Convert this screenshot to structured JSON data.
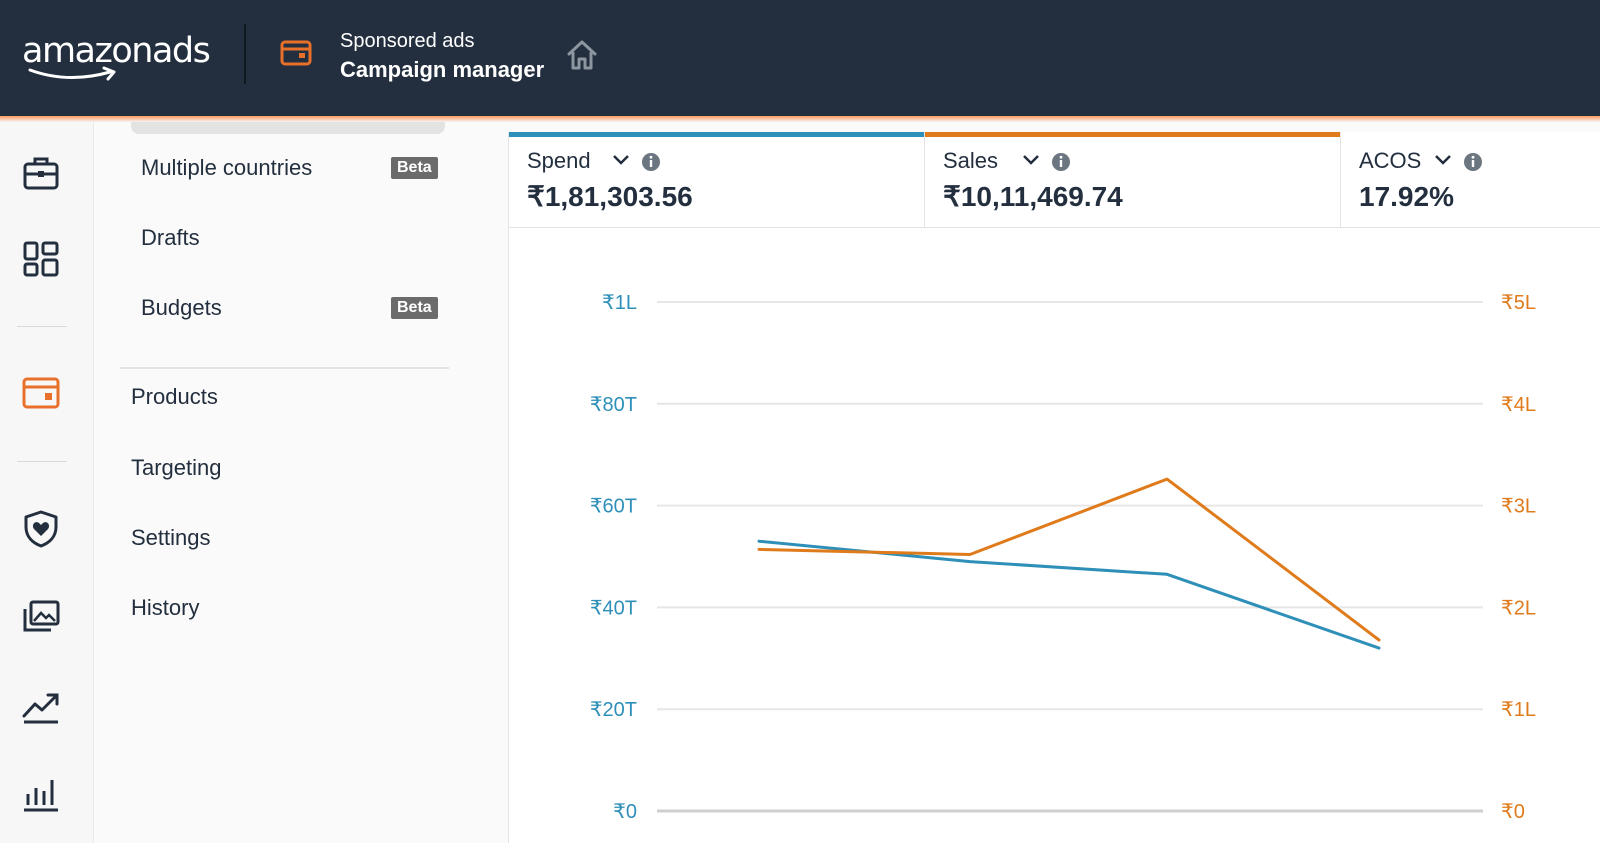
{
  "header": {
    "logo_text": "amazonads",
    "subtitle": "Sponsored ads",
    "title": "Campaign manager"
  },
  "rail": {
    "icons": [
      "briefcase-icon",
      "dashboard-icon",
      "campaign-card-icon",
      "shield-heart-icon",
      "media-library-icon",
      "trend-icon",
      "bar-chart-icon"
    ],
    "active_color": "#e8702a"
  },
  "subnav": {
    "items": [
      {
        "label": "Multiple countries",
        "badge": "Beta"
      },
      {
        "label": "Drafts"
      },
      {
        "label": "Budgets",
        "badge": "Beta"
      }
    ],
    "sections": [
      {
        "label": "Products"
      },
      {
        "label": "Targeting"
      },
      {
        "label": "Settings"
      },
      {
        "label": "History"
      }
    ]
  },
  "metrics": [
    {
      "label": "Spend",
      "value": "₹1,81,303.56",
      "color": "#2e8fb8"
    },
    {
      "label": "Sales",
      "value": "₹10,11,469.74",
      "color": "#e07b1b"
    },
    {
      "label": "ACOS",
      "value": "17.92%",
      "color": ""
    }
  ],
  "chart_data": {
    "type": "line",
    "left_axis": {
      "ticks": [
        "₹0",
        "₹20T",
        "₹40T",
        "₹60T",
        "₹80T",
        "₹1L"
      ],
      "range": [
        0,
        100000
      ],
      "color": "#2e8fb8"
    },
    "right_axis": {
      "ticks": [
        "₹0",
        "₹1L",
        "₹2L",
        "₹3L",
        "₹4L",
        "₹5L"
      ],
      "range": [
        0,
        500000
      ],
      "color": "#e07b1b"
    },
    "grid": true,
    "series": [
      {
        "axis": "left",
        "color": "#2e8fb8",
        "values": [
          53000,
          49000,
          46500,
          32000
        ]
      },
      {
        "axis": "right",
        "color": "#e07b1b",
        "values": [
          257000,
          252000,
          326000,
          168000
        ]
      }
    ]
  }
}
